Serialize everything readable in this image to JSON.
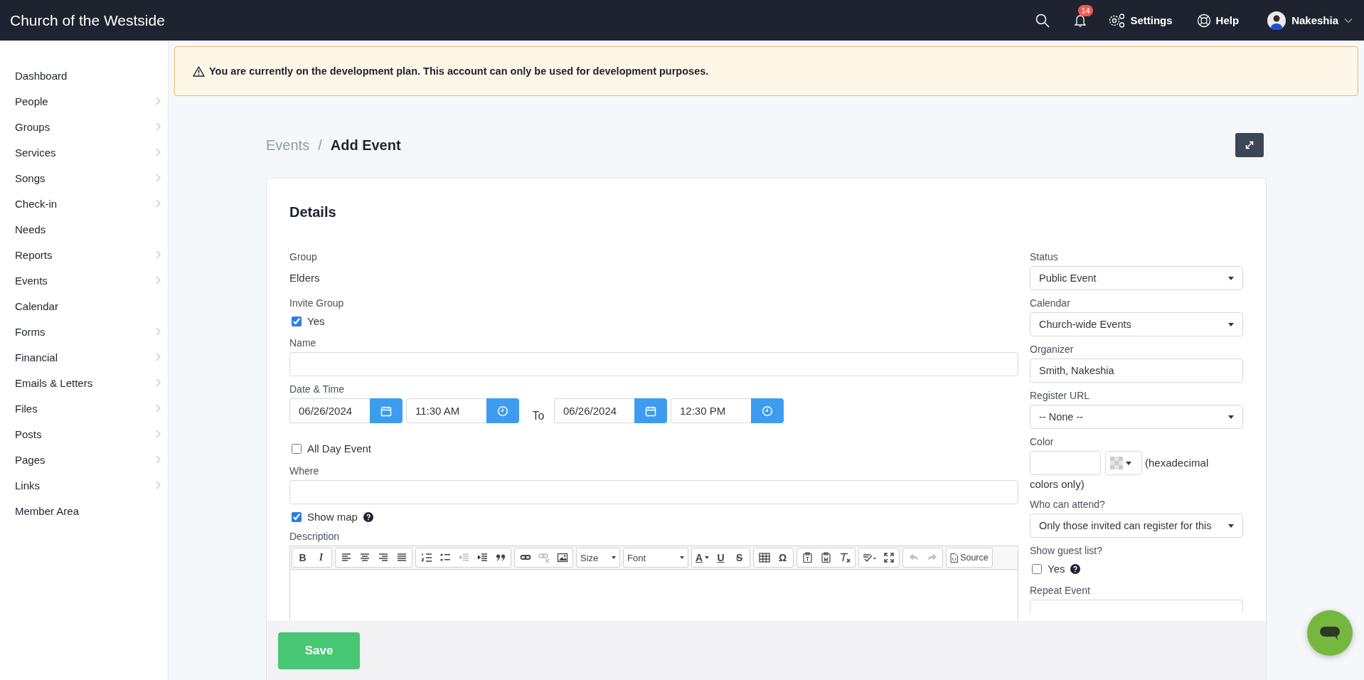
{
  "app": {
    "title": "Church of the Westside"
  },
  "topbar": {
    "notification_count": "14",
    "settings": "Settings",
    "help": "Help",
    "user": "Nakeshia"
  },
  "sidebar": {
    "items": [
      {
        "label": "Dashboard",
        "expandable": false
      },
      {
        "label": "People",
        "expandable": true
      },
      {
        "label": "Groups",
        "expandable": true
      },
      {
        "label": "Services",
        "expandable": true
      },
      {
        "label": "Songs",
        "expandable": true
      },
      {
        "label": "Check-in",
        "expandable": true
      },
      {
        "label": "Needs",
        "expandable": false
      },
      {
        "label": "Reports",
        "expandable": true
      },
      {
        "label": "Events",
        "expandable": true
      },
      {
        "label": "Calendar",
        "expandable": false
      },
      {
        "label": "Forms",
        "expandable": true
      },
      {
        "label": "Financial",
        "expandable": true
      },
      {
        "label": "Emails & Letters",
        "expandable": true
      },
      {
        "label": "Files",
        "expandable": true
      },
      {
        "label": "Posts",
        "expandable": true
      },
      {
        "label": "Pages",
        "expandable": true
      },
      {
        "label": "Links",
        "expandable": true
      },
      {
        "label": "Member Area",
        "expandable": false
      }
    ]
  },
  "alert": {
    "text": "You are currently on the development plan. This account can only be used for development purposes."
  },
  "breadcrumb": {
    "parent": "Events",
    "separator": "/",
    "current": "Add Event"
  },
  "card": {
    "title": "Details"
  },
  "left_fields": [
    {
      "kind": "static",
      "label": "Group",
      "value": "Elders"
    },
    {
      "kind": "checkbox",
      "label": "Invite Group",
      "option": "Yes",
      "checked": true,
      "help": false
    },
    {
      "kind": "text",
      "label": "Name"
    },
    {
      "kind": "datetime",
      "label": "Date & Time",
      "start_date": "06/26/2024",
      "start_time": "11:30 AM",
      "separator": "To",
      "end_date": "06/26/2024",
      "end_time": "12:30 PM"
    },
    {
      "kind": "checkbox",
      "option": "All Day Event",
      "checked": false,
      "help": false
    },
    {
      "kind": "text",
      "label": "Where"
    },
    {
      "kind": "checkbox",
      "option": "Show map",
      "checked": true,
      "help": true
    },
    {
      "kind": "editor",
      "label": "Description"
    }
  ],
  "toolbar": {
    "groups": [
      {
        "items": [
          {
            "kind": "bold",
            "label": "B",
            "disabled": false
          },
          {
            "kind": "italic",
            "label": "I",
            "disabled": false
          }
        ]
      },
      {
        "items": [
          {
            "kind": "align-left",
            "disabled": false
          },
          {
            "kind": "align-center",
            "disabled": false
          },
          {
            "kind": "align-right",
            "disabled": false
          },
          {
            "kind": "justify",
            "disabled": false
          }
        ]
      },
      {
        "items": [
          {
            "kind": "numbered-list",
            "disabled": false
          },
          {
            "kind": "bullet-list",
            "disabled": false
          },
          {
            "kind": "outdent",
            "disabled": true
          },
          {
            "kind": "indent",
            "disabled": false
          },
          {
            "kind": "quote",
            "disabled": false
          }
        ]
      },
      {
        "items": [
          {
            "kind": "link",
            "disabled": false
          },
          {
            "kind": "unlink",
            "disabled": true
          },
          {
            "kind": "image",
            "disabled": false
          }
        ]
      },
      {
        "items": [
          {
            "kind": "size",
            "label": "Size",
            "disabled": false
          }
        ]
      },
      {
        "items": [
          {
            "kind": "font",
            "label": "Font",
            "disabled": false
          }
        ]
      },
      {
        "items": [
          {
            "kind": "text-color",
            "label": "A",
            "disabled": false
          },
          {
            "kind": "underline",
            "label": "U",
            "disabled": false
          },
          {
            "kind": "strike",
            "label": "S",
            "disabled": false
          }
        ]
      },
      {
        "items": [
          {
            "kind": "table",
            "disabled": false
          },
          {
            "kind": "symbol",
            "label": "Ω",
            "disabled": false
          }
        ]
      },
      {
        "items": [
          {
            "kind": "paste-text",
            "disabled": false
          },
          {
            "kind": "paste-word",
            "disabled": false
          },
          {
            "kind": "clear-format",
            "disabled": false
          }
        ]
      },
      {
        "items": [
          {
            "kind": "spellcheck",
            "disabled": false
          },
          {
            "kind": "maximize",
            "disabled": false
          }
        ]
      },
      {
        "items": [
          {
            "kind": "undo",
            "disabled": true
          },
          {
            "kind": "redo",
            "disabled": true
          }
        ]
      },
      {
        "items": [
          {
            "kind": "source",
            "label": "Source",
            "disabled": false
          }
        ]
      }
    ]
  },
  "right_fields": [
    {
      "kind": "select",
      "label": "Status",
      "value": "Public Event"
    },
    {
      "kind": "select",
      "label": "Calendar",
      "value": "Church-wide Events"
    },
    {
      "kind": "text",
      "label": "Organizer",
      "value": "Smith, Nakeshia"
    },
    {
      "kind": "select",
      "label": "Register URL",
      "value": "-- None --"
    },
    {
      "kind": "color",
      "label": "Color",
      "note_lines": [
        "(hexadecimal",
        "colors only)"
      ]
    },
    {
      "kind": "select",
      "label": "Who can attend?",
      "value": "Only those invited can register for this"
    },
    {
      "kind": "checkbox",
      "label": "Show guest list?",
      "option": "Yes",
      "checked": false,
      "help": true
    },
    {
      "kind": "select",
      "label": "Repeat Event"
    }
  ],
  "footer": {
    "save": "Save"
  }
}
